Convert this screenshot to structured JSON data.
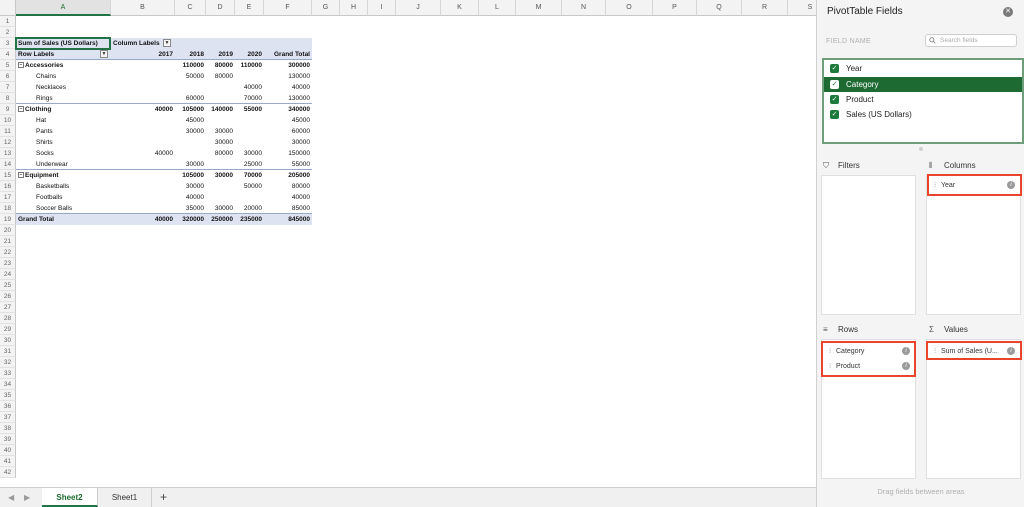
{
  "columns": [
    "A",
    "B",
    "C",
    "D",
    "E",
    "F",
    "G",
    "H",
    "I",
    "J",
    "K",
    "L",
    "M",
    "N",
    "O",
    "P",
    "Q",
    "R",
    "S"
  ],
  "rows": [
    "1",
    "2",
    "3",
    "4",
    "5",
    "6",
    "7",
    "8",
    "9",
    "10",
    "11",
    "12",
    "13",
    "14",
    "15",
    "16",
    "17",
    "18",
    "19",
    "20",
    "21",
    "22",
    "23",
    "24",
    "25",
    "26",
    "27",
    "28",
    "29",
    "30",
    "31",
    "32",
    "33",
    "34",
    "35",
    "36",
    "37",
    "38",
    "39",
    "40",
    "41",
    "42"
  ],
  "pivot": {
    "value_header": "Sum of Sales (US Dollars)",
    "column_labels": "Column Labels",
    "row_labels": "Row Labels",
    "years": [
      "2017",
      "2018",
      "2019",
      "2020"
    ],
    "grand_total_header": "Grand Total",
    "table": [
      {
        "label": "Accessories",
        "level": 0,
        "vals": [
          "",
          "110000",
          "80000",
          "110000",
          "300000"
        ]
      },
      {
        "label": "Chains",
        "level": 1,
        "vals": [
          "",
          "50000",
          "80000",
          "",
          "130000"
        ]
      },
      {
        "label": "Necklaces",
        "level": 1,
        "vals": [
          "",
          "",
          "",
          "40000",
          "40000"
        ]
      },
      {
        "label": "Rings",
        "level": 1,
        "vals": [
          "",
          "60000",
          "",
          "70000",
          "130000"
        ]
      },
      {
        "label": "Clothing",
        "level": 0,
        "vals": [
          "40000",
          "105000",
          "140000",
          "55000",
          "340000"
        ]
      },
      {
        "label": "Hat",
        "level": 1,
        "vals": [
          "",
          "45000",
          "",
          "",
          "45000"
        ]
      },
      {
        "label": "Pants",
        "level": 1,
        "vals": [
          "",
          "30000",
          "30000",
          "",
          "60000"
        ]
      },
      {
        "label": "Shirts",
        "level": 1,
        "vals": [
          "",
          "",
          "30000",
          "",
          "30000"
        ]
      },
      {
        "label": "Socks",
        "level": 1,
        "vals": [
          "40000",
          "",
          "80000",
          "30000",
          "150000"
        ]
      },
      {
        "label": "Underwear",
        "level": 1,
        "vals": [
          "",
          "30000",
          "",
          "25000",
          "55000"
        ]
      },
      {
        "label": "Equipment",
        "level": 0,
        "vals": [
          "",
          "105000",
          "30000",
          "70000",
          "205000"
        ]
      },
      {
        "label": "Basketballs",
        "level": 1,
        "vals": [
          "",
          "30000",
          "",
          "50000",
          "80000"
        ]
      },
      {
        "label": "Footballs",
        "level": 1,
        "vals": [
          "",
          "40000",
          "",
          "",
          "40000"
        ]
      },
      {
        "label": "Soccer Balls",
        "level": 1,
        "vals": [
          "",
          "35000",
          "30000",
          "20000",
          "85000"
        ]
      },
      {
        "label": "Grand Total",
        "level": 2,
        "vals": [
          "40000",
          "320000",
          "250000",
          "235000",
          "845000"
        ]
      }
    ],
    "collapse_glyph": "⊟",
    "dropdown_glyph": "▼"
  },
  "tabs": {
    "sheets": [
      "Sheet2",
      "Sheet1"
    ],
    "active": "Sheet2",
    "add": "+",
    "prev": "◀",
    "next": "▶"
  },
  "pane": {
    "title": "PivotTable Fields",
    "close": "✕",
    "field_name_label": "FIELD NAME",
    "search_placeholder": "Search fields",
    "fields": [
      {
        "label": "Year",
        "checked": true
      },
      {
        "label": "Category",
        "checked": true,
        "highlighted": true
      },
      {
        "label": "Product",
        "checked": true
      },
      {
        "label": "Sales (US Dollars)",
        "checked": true
      }
    ],
    "check_glyph": "✓",
    "filters_label": "Filters",
    "columns_label": "Columns",
    "rows_label": "Rows",
    "values_label": "Values",
    "columns_items": [
      "Year"
    ],
    "rows_items": [
      "Category",
      "Product"
    ],
    "values_items": [
      "Sum of Sales (U..."
    ],
    "grip_glyph": "⁝",
    "info_glyph": "i",
    "filters_icon": "⛉",
    "columns_icon": "⦀",
    "rows_icon": "≡",
    "values_icon": "Σ",
    "drag_hint": "Drag fields between areas"
  },
  "colors": {
    "accent": "#217346",
    "highlight": "#1d6b32",
    "annotation": "#e8452c",
    "pivot_band": "#dde3f1"
  }
}
